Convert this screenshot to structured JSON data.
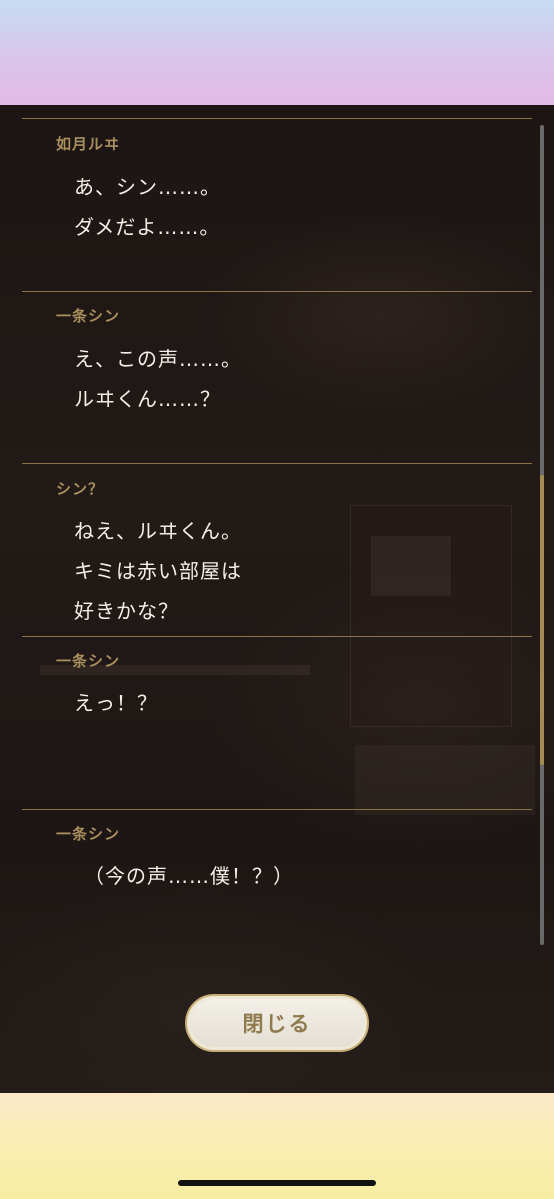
{
  "log": {
    "entries": [
      {
        "speaker": "如月ルヰ",
        "lines": [
          "あ、シン……。",
          "ダメだよ……。"
        ]
      },
      {
        "speaker": "一条シン",
        "lines": [
          "え、この声……。",
          "ルヰくん……？"
        ]
      },
      {
        "speaker": "シン？",
        "lines": [
          "ねえ、ルヰくん。",
          "キミは赤い部屋は",
          "好きかな？"
        ]
      },
      {
        "speaker": "一条シン",
        "lines": [
          "えっ！？"
        ]
      },
      {
        "speaker": "一条シン",
        "lines": [
          "（今の声……僕！？）"
        ]
      }
    ]
  },
  "close_button": {
    "label": "閉じる"
  },
  "colors": {
    "speaker": "#a98f5e",
    "text": "#f4efe7",
    "divider": "#8a7446",
    "panel": "#1e1714",
    "button_text": "#8e7a4c"
  }
}
